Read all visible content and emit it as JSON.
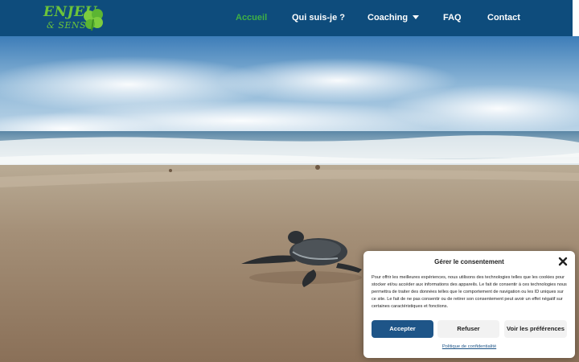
{
  "brand": {
    "logo_line1": "ENJEU",
    "logo_line2": "& SENS",
    "logo_color": "#6cc43a"
  },
  "header": {
    "background": "#0e4c7c"
  },
  "nav": {
    "items": [
      {
        "label": "Accueil",
        "active": true
      },
      {
        "label": "Qui suis-je ?"
      },
      {
        "label": "Coaching",
        "has_dropdown": true
      },
      {
        "label": "FAQ"
      },
      {
        "label": "Contact"
      }
    ],
    "active_color": "#3fb045"
  },
  "hero": {
    "image_subject": "baby sea turtle on beach"
  },
  "consent": {
    "title": "Gérer le consentement",
    "body": "Pour offrir les meilleures expériences, nous utilisons des technologies telles que les cookies pour stocker et/ou accéder aux informations des appareils. Le fait de consentir à ces technologies nous permettra de traiter des données telles que le comportement de navigation ou les ID uniques sur ce site. Le fait de ne pas consentir ou de retirer son consentement peut avoir un effet négatif sur certaines caractéristiques et fonctions.",
    "accept_label": "Accepter",
    "refuse_label": "Refuser",
    "prefs_label": "Voir les préférences",
    "policy_link": "Politique de confidentialité",
    "accent": "#1e5588"
  }
}
